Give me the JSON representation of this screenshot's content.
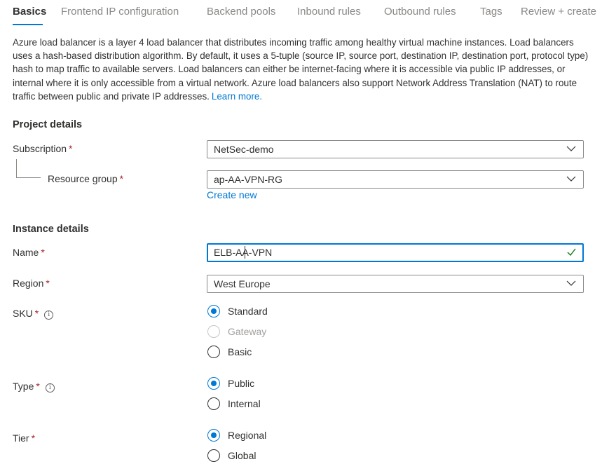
{
  "tabs": [
    {
      "label": "Basics",
      "active": true
    },
    {
      "label": "Frontend IP configuration",
      "active": false
    },
    {
      "label": "Backend pools",
      "active": false
    },
    {
      "label": "Inbound rules",
      "active": false
    },
    {
      "label": "Outbound rules",
      "active": false
    },
    {
      "label": "Tags",
      "active": false
    },
    {
      "label": "Review + create",
      "active": false
    }
  ],
  "description": {
    "text": "Azure load balancer is a layer 4 load balancer that distributes incoming traffic among healthy virtual machine instances. Load balancers uses a hash-based distribution algorithm. By default, it uses a 5-tuple (source IP, source port, destination IP, destination port, protocol type) hash to map traffic to available servers. Load balancers can either be internet-facing where it is accessible via public IP addresses, or internal where it is only accessible from a virtual network. Azure load balancers also support Network Address Translation (NAT) to route traffic between public and private IP addresses.",
    "link": "Learn more."
  },
  "project_details": {
    "title": "Project details",
    "subscription": {
      "label": "Subscription",
      "value": "NetSec-demo"
    },
    "resource_group": {
      "label": "Resource group",
      "value": "ap-AA-VPN-RG",
      "create_new": "Create new"
    }
  },
  "instance_details": {
    "title": "Instance details",
    "name": {
      "label": "Name",
      "value": "ELB-AA-VPN"
    },
    "region": {
      "label": "Region",
      "value": "West Europe"
    },
    "sku": {
      "label": "SKU",
      "options": [
        "Standard",
        "Gateway",
        "Basic"
      ],
      "selected": "Standard"
    },
    "type": {
      "label": "Type",
      "options": [
        "Public",
        "Internal"
      ],
      "selected": "Public"
    },
    "tier": {
      "label": "Tier",
      "options": [
        "Regional",
        "Global"
      ],
      "selected": "Regional"
    }
  },
  "required_marker": "*",
  "info_glyph": "i",
  "colors": {
    "accent": "#0078d4",
    "required": "#a4262c",
    "valid": "#107c10"
  }
}
